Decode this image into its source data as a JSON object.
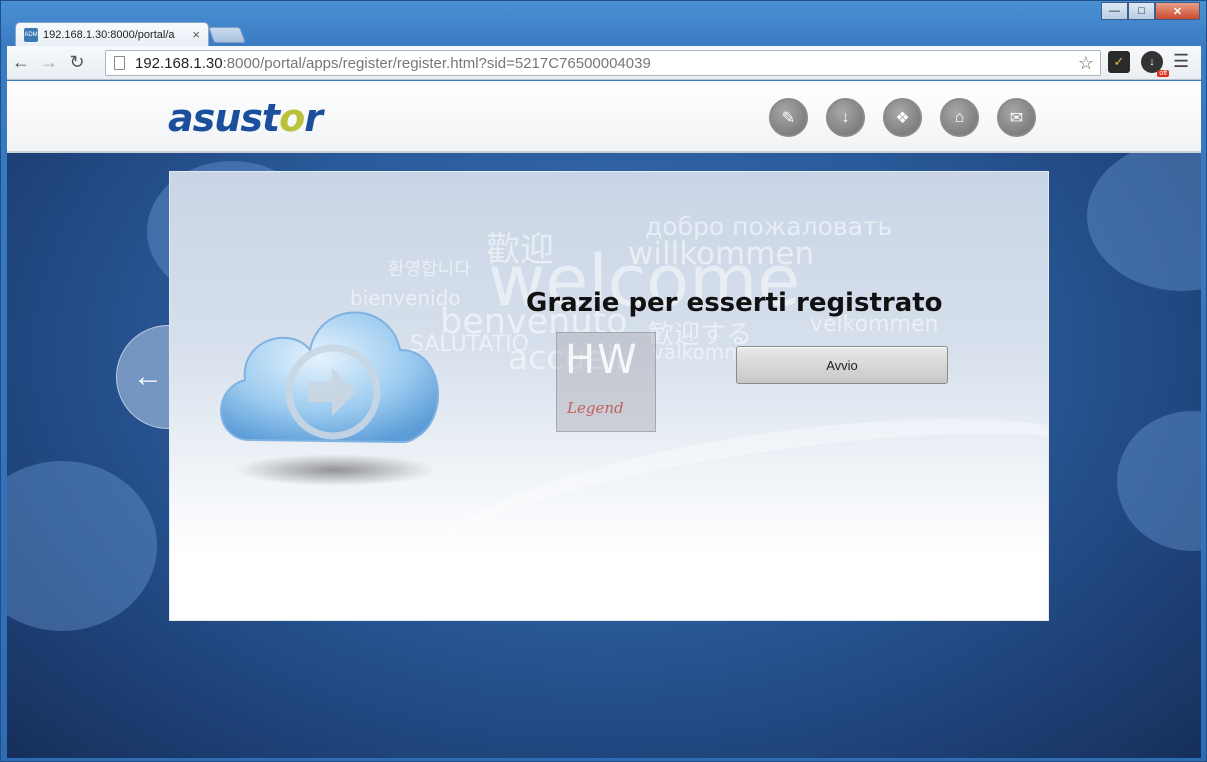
{
  "browser": {
    "tab_title": "192.168.1.30:8000/portal/a",
    "tab_favicon_text": "ADM",
    "url_host": "192.168.1.30",
    "url_rest": ":8000/portal/apps/register/register.html?sid=5217C76500004039",
    "ext_badge": "off"
  },
  "header": {
    "logo_main": "asust",
    "logo_accent": "o",
    "logo_end": "r"
  },
  "background_words": {
    "big": "welcome",
    "dobro": "добро пожаловать",
    "willkommen": "willkommen",
    "huan": "歡迎",
    "kr": "환영합니다",
    "benvenido": "bienvenido",
    "benvenuto": "benvenuto",
    "jp": "歓迎する",
    "velkommen": "velkommen",
    "salutatio": "SALUTATIO",
    "accueil": "accueil",
    "valkom": "välkommen"
  },
  "main": {
    "title": "Grazie per esserti registrato",
    "start_button": "Avvio"
  },
  "watermark": {
    "top": "HW",
    "bottom": "Legend"
  },
  "colors": {
    "brand_blue": "#1b4f9c",
    "brand_accent": "#b8c23a"
  }
}
